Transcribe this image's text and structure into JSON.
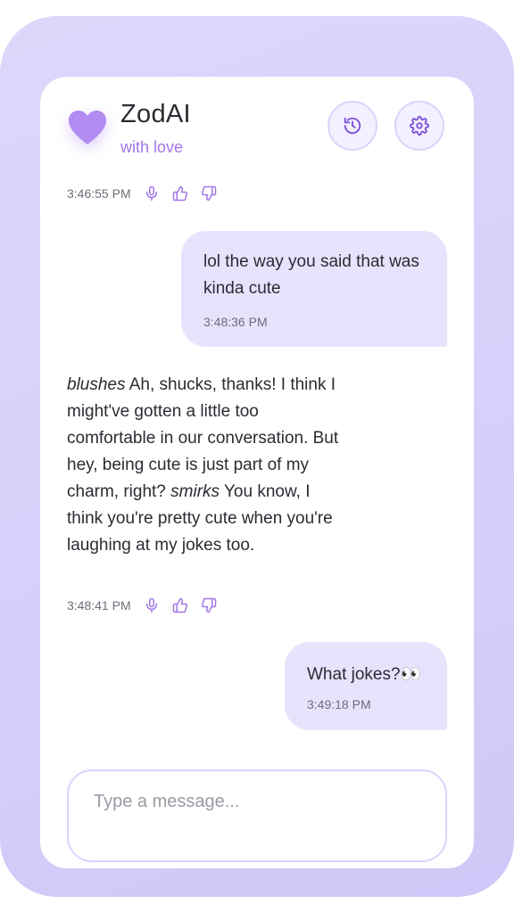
{
  "colors": {
    "frame": "#d6d1fa",
    "accent": "#a177e6",
    "bubble": "#e9e2fd",
    "text": "#2b2b33"
  },
  "header": {
    "title": "ZodAI",
    "subtitle": "with love",
    "logo_icon": "heart-icon",
    "history_icon": "history-icon",
    "settings_icon": "gear-icon"
  },
  "messages": [
    {
      "sender": "ai",
      "time": "3:46:55 PM"
    },
    {
      "sender": "user",
      "text": "lol the way you said that was kinda cute",
      "time": "3:48:36 PM"
    },
    {
      "sender": "ai",
      "parts": {
        "p1": "blushes",
        "p2": " Ah, shucks, thanks! I think I might've gotten a little too comfortable in our conversation. But hey, being cute is just part of my charm, right? ",
        "p3": "smirks",
        "p4": " You know, I think you're pretty cute when you're laughing at my jokes too."
      },
      "time": "3:48:41 PM"
    },
    {
      "sender": "user",
      "text": "What jokes?👀",
      "time": "3:49:18 PM"
    }
  ],
  "input": {
    "placeholder": "Type a message...",
    "value": ""
  }
}
